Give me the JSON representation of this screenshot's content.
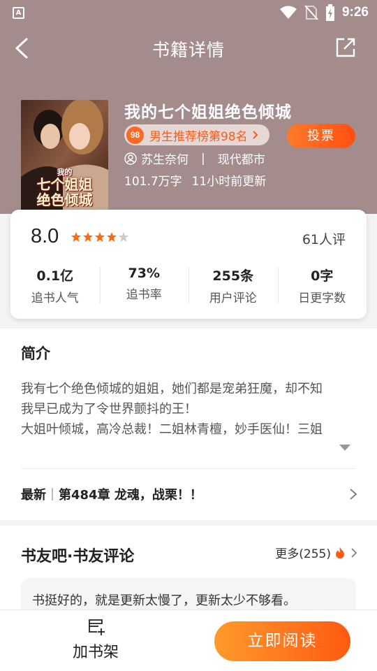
{
  "status_bar": {
    "time": "9:26",
    "app_badge": "A"
  },
  "nav": {
    "title": "书籍详情"
  },
  "book": {
    "title": "我的七个姐姐绝色倾城",
    "cover_title_small": "我的",
    "cover_title_line1": "七个姐姐",
    "cover_title_line2": "绝色倾城",
    "rank_number": "98",
    "rank_text": "男生推荐榜第98名",
    "vote_label": "投票",
    "author": "苏生奈何",
    "separator": "|",
    "category": "现代都市",
    "word_count": "101.7万字",
    "update_time": "11小时前更新"
  },
  "stats": {
    "score": "8.0",
    "stars_filled": 4,
    "stars_total": 5,
    "ratings_count": "61人评",
    "items": [
      {
        "value": "0.1亿",
        "label": "追书人气"
      },
      {
        "value": "73%",
        "label": "追书率"
      },
      {
        "value": "255条",
        "label": "用户评论"
      },
      {
        "value": "0字",
        "label": "日更字数"
      }
    ]
  },
  "intro": {
    "title": "简介",
    "lines": [
      "我有七个绝色倾城的姐姐，她们都是宠弟狂魔，却不知",
      "我早已成为了令世界颤抖的王！",
      "大姐叶倾城，高冷总裁！二姐林青檀，妙手医仙！三姐"
    ],
    "latest_label": "最新",
    "latest_chapter": "第484章 龙魂，战栗！！"
  },
  "comments": {
    "title": "书友吧·书友评论",
    "more_label": "更多(255)",
    "first_comment": "书挺好的，就是更新太慢了，更新太少不够看。"
  },
  "bottom": {
    "shelf_label": "加书架",
    "read_label": "立即阅读"
  },
  "colors": {
    "header_bg": "#a48c8c",
    "accent_orange": "#ff5a14",
    "star": "#ff6a10"
  }
}
